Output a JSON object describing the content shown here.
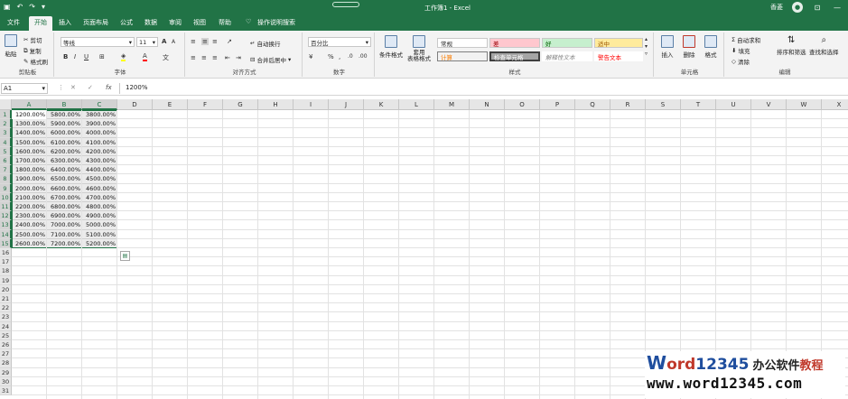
{
  "titlebar": {
    "doc_title": "工作簿1 - Excel",
    "user": "香菱",
    "qat": [
      "save-icon",
      "undo-icon",
      "redo-icon"
    ],
    "window_buttons": [
      "—",
      "☐",
      "✕"
    ]
  },
  "tabs": [
    {
      "label": "文件"
    },
    {
      "label": "开始"
    },
    {
      "label": "插入"
    },
    {
      "label": "页面布局"
    },
    {
      "label": "公式"
    },
    {
      "label": "数据"
    },
    {
      "label": "审阅"
    },
    {
      "label": "视图"
    },
    {
      "label": "帮助"
    },
    {
      "label": "操作说明搜索"
    }
  ],
  "ribbon": {
    "clipboard": {
      "label": "剪贴板",
      "paste": "粘贴",
      "cut": "剪切",
      "copy": "复制",
      "painter": "格式刷"
    },
    "font": {
      "label": "字体",
      "name": "等线",
      "size": "11",
      "bold": "B",
      "italic": "I",
      "underline": "U",
      "grow": "A",
      "shrink": "A"
    },
    "alignment": {
      "label": "对齐方式",
      "wrap": "自动换行",
      "merge": "合并后居中"
    },
    "number": {
      "label": "数字",
      "format": "百分比",
      "percent": "%"
    },
    "styles": {
      "label": "样式",
      "conditional": "条件格式",
      "table": "套用\n表格格式",
      "cells": [
        {
          "text": "常规",
          "bg": "#ffffff",
          "fg": "#222222"
        },
        {
          "text": "差",
          "bg": "#ffc7ce",
          "fg": "#9c0006"
        },
        {
          "text": "好",
          "bg": "#c6efce",
          "fg": "#006100"
        },
        {
          "text": "适中",
          "bg": "#ffeb9c",
          "fg": "#9c5700"
        },
        {
          "text": "计算",
          "bg": "#f2f2f2",
          "fg": "#fa7d00"
        },
        {
          "text": "检查单元格",
          "bg": "#a5a5a5",
          "fg": "#ffffff"
        },
        {
          "text": "解释性文本",
          "bg": "#ffffff",
          "fg": "#7f7f7f"
        },
        {
          "text": "警告文本",
          "bg": "#ffffff",
          "fg": "#ff0000"
        }
      ]
    },
    "cells": {
      "label": "单元格",
      "insert": "插入",
      "delete": "删除",
      "format": "格式"
    },
    "editing": {
      "label": "编辑",
      "autosum": "自动求和",
      "fill": "填充",
      "clear": "清除",
      "sort": "排序和筛选",
      "find": "查找和选择"
    }
  },
  "formula_bar": {
    "name_box": "A1",
    "fx": "fx",
    "value": "1200%"
  },
  "grid": {
    "columns": [
      "A",
      "B",
      "C",
      "D",
      "E",
      "F",
      "G",
      "H",
      "I",
      "J",
      "K",
      "L",
      "M",
      "N",
      "O",
      "P",
      "Q",
      "R",
      "S",
      "T",
      "U",
      "V",
      "W",
      "X"
    ],
    "rows": [
      "1",
      "2",
      "3",
      "4",
      "5",
      "6",
      "7",
      "8",
      "9",
      "10",
      "11",
      "12",
      "13",
      "14",
      "15",
      "16",
      "17",
      "18",
      "19",
      "20",
      "21",
      "22",
      "23",
      "24",
      "25",
      "26",
      "27",
      "28",
      "29",
      "30",
      "31"
    ],
    "data": [
      [
        "1200.00%",
        "5800.00%",
        "3800.00%"
      ],
      [
        "1300.00%",
        "5900.00%",
        "3900.00%"
      ],
      [
        "1400.00%",
        "6000.00%",
        "4000.00%"
      ],
      [
        "1500.00%",
        "6100.00%",
        "4100.00%"
      ],
      [
        "1600.00%",
        "6200.00%",
        "4200.00%"
      ],
      [
        "1700.00%",
        "6300.00%",
        "4300.00%"
      ],
      [
        "1800.00%",
        "6400.00%",
        "4400.00%"
      ],
      [
        "1900.00%",
        "6500.00%",
        "4500.00%"
      ],
      [
        "2000.00%",
        "6600.00%",
        "4600.00%"
      ],
      [
        "2100.00%",
        "6700.00%",
        "4700.00%"
      ],
      [
        "2200.00%",
        "6800.00%",
        "4800.00%"
      ],
      [
        "2300.00%",
        "6900.00%",
        "4900.00%"
      ],
      [
        "2400.00%",
        "7000.00%",
        "5000.00%"
      ],
      [
        "2500.00%",
        "7100.00%",
        "5100.00%"
      ],
      [
        "2600.00%",
        "7200.00%",
        "5200.00%"
      ]
    ]
  },
  "watermark": {
    "w": "W",
    "ord": "ord",
    "num": "12345",
    "cn1": "办公软件",
    "cn2": "教程",
    "url": "www.word12345.com"
  }
}
